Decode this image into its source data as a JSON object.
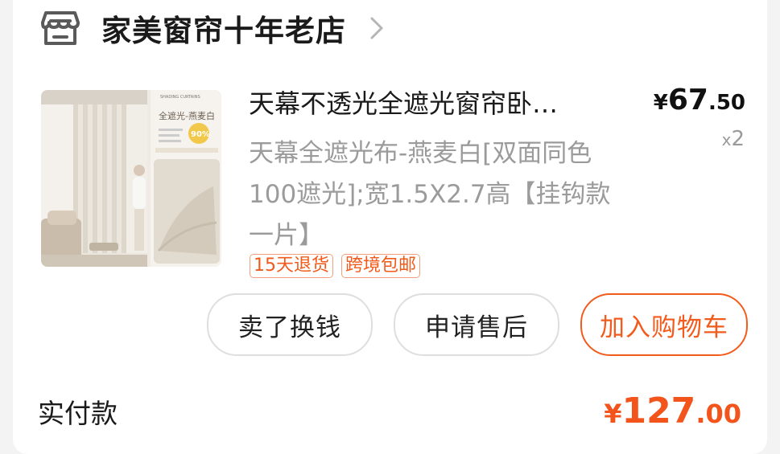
{
  "shop": {
    "name": "家美窗帘十年老店",
    "icon": "store-icon"
  },
  "product": {
    "title": "天幕不透光全遮光窗帘卧…",
    "sku": "天幕全遮光布-燕麦白[双面同色100遮光];宽1.5X2.7高【挂钩款一片】",
    "price": {
      "currency": "¥",
      "integer": "67",
      "decimal": ".50"
    },
    "quantity": {
      "prefix": "x",
      "value": "2"
    },
    "tags": [
      "15天退货",
      "跨境包邮"
    ],
    "thumbnail": {
      "banner": "SHADING CURTAINS",
      "heading": "全遮光-燕麦白",
      "badge": "90%"
    }
  },
  "actions": {
    "sell": "卖了换钱",
    "after_sales": "申请售后",
    "add_to_cart": "加入购物车"
  },
  "payment": {
    "label": "实付款",
    "currency": "¥",
    "integer": "127",
    "decimal": ".00"
  },
  "colors": {
    "accent": "#f25b1c",
    "tag_border": "#f2a07c",
    "muted_text": "#9b9b9b",
    "button_border": "#dedede"
  }
}
